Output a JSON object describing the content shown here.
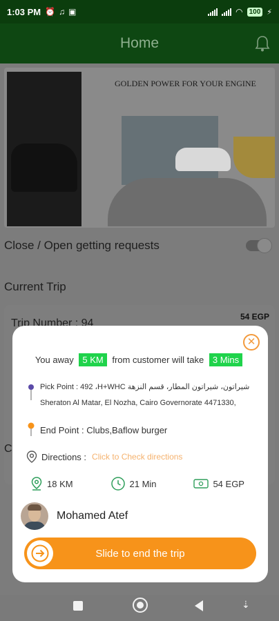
{
  "status_bar": {
    "time": "1:03 PM",
    "battery": "100"
  },
  "header": {
    "title": "Home"
  },
  "banner": {
    "caption": "GOLDEN POWER FOR YOUR ENGINE"
  },
  "requests_toggle": {
    "label": "Close / Open getting requests",
    "on": false
  },
  "current_trip": {
    "heading": "Current Trip",
    "trip_number": "Trip Number : 94",
    "price": "54 EGP",
    "partial_label": "C"
  },
  "modal": {
    "away": {
      "prefix": "You away",
      "distance": "5 KM",
      "middle": "from customer will take",
      "time": "3 Mins"
    },
    "pick_point": {
      "line1": "Pick Point : 492 ،H+WHC شيراتون، شيراتون المطار، قسم النزهة",
      "line2": "Sheraton Al Matar, El Nozha, Cairo Governorate 4471330,"
    },
    "end_point": "End Point : Clubs,Baflow burger",
    "directions": {
      "label": "Directions :",
      "link": "Click to Check directions"
    },
    "stats": {
      "distance": "18 KM",
      "duration": "21 Min",
      "price": "54 EGP"
    },
    "driver": {
      "name": "Mohamed Atef"
    },
    "slide_label": "Slide to end the trip"
  },
  "colors": {
    "header": "#0e4712",
    "accent": "#f7931a",
    "highlight": "#1fd34b"
  }
}
